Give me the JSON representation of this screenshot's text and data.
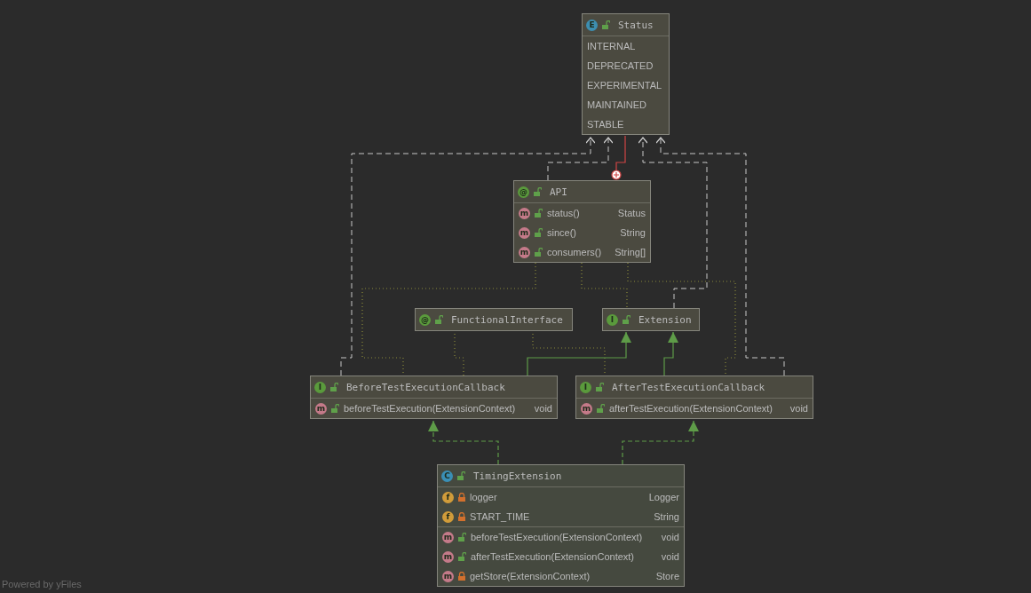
{
  "diagram": {
    "nodes": [
      {
        "kind": "enum",
        "badge": "E",
        "public": true,
        "name": "Status",
        "sections": [
          [
            {
              "kind": "constant",
              "name": "INTERNAL"
            },
            {
              "kind": "constant",
              "name": "DEPRECATED"
            },
            {
              "kind": "constant",
              "name": "EXPERIMENTAL"
            },
            {
              "kind": "constant",
              "name": "MAINTAINED"
            },
            {
              "kind": "constant",
              "name": "STABLE"
            }
          ]
        ]
      },
      {
        "kind": "annotation",
        "badge": "@",
        "public": true,
        "name": "API",
        "sections": [
          [
            {
              "kind": "method",
              "badge": "m",
              "public": true,
              "name": "status()",
              "type": "Status"
            },
            {
              "kind": "method",
              "badge": "m",
              "public": true,
              "name": "since()",
              "type": "String"
            },
            {
              "kind": "method",
              "badge": "m",
              "public": true,
              "name": "consumers()",
              "type": "String[]"
            }
          ]
        ]
      },
      {
        "kind": "annotation",
        "badge": "@",
        "public": true,
        "name": "FunctionalInterface"
      },
      {
        "kind": "interface",
        "badge": "I",
        "public": true,
        "name": "Extension"
      },
      {
        "kind": "interface",
        "badge": "I",
        "public": true,
        "name": "BeforeTestExecutionCallback",
        "sections": [
          [
            {
              "kind": "method",
              "badge": "m",
              "public": true,
              "name": "beforeTestExecution(ExtensionContext)",
              "type": "void"
            }
          ]
        ]
      },
      {
        "kind": "interface",
        "badge": "I",
        "public": true,
        "name": "AfterTestExecutionCallback",
        "sections": [
          [
            {
              "kind": "method",
              "badge": "m",
              "public": true,
              "name": "afterTestExecution(ExtensionContext)",
              "type": "void"
            }
          ]
        ]
      },
      {
        "kind": "class",
        "badge": "C",
        "public": true,
        "name": "TimingExtension",
        "sections": [
          [
            {
              "kind": "field",
              "badge": "f",
              "public": false,
              "name": "logger",
              "type": "Logger"
            },
            {
              "kind": "field",
              "badge": "f",
              "public": false,
              "name": "START_TIME",
              "type": "String"
            }
          ],
          [
            {
              "kind": "method",
              "badge": "m",
              "public": true,
              "name": "beforeTestExecution(ExtensionContext)",
              "type": "void"
            },
            {
              "kind": "method",
              "badge": "m",
              "public": true,
              "name": "afterTestExecution(ExtensionContext)",
              "type": "void"
            },
            {
              "kind": "method",
              "badge": "m",
              "public": false,
              "name": "getStore(ExtensionContext)",
              "type": "Store"
            }
          ]
        ]
      }
    ]
  },
  "footer": "Powered by yFiles"
}
